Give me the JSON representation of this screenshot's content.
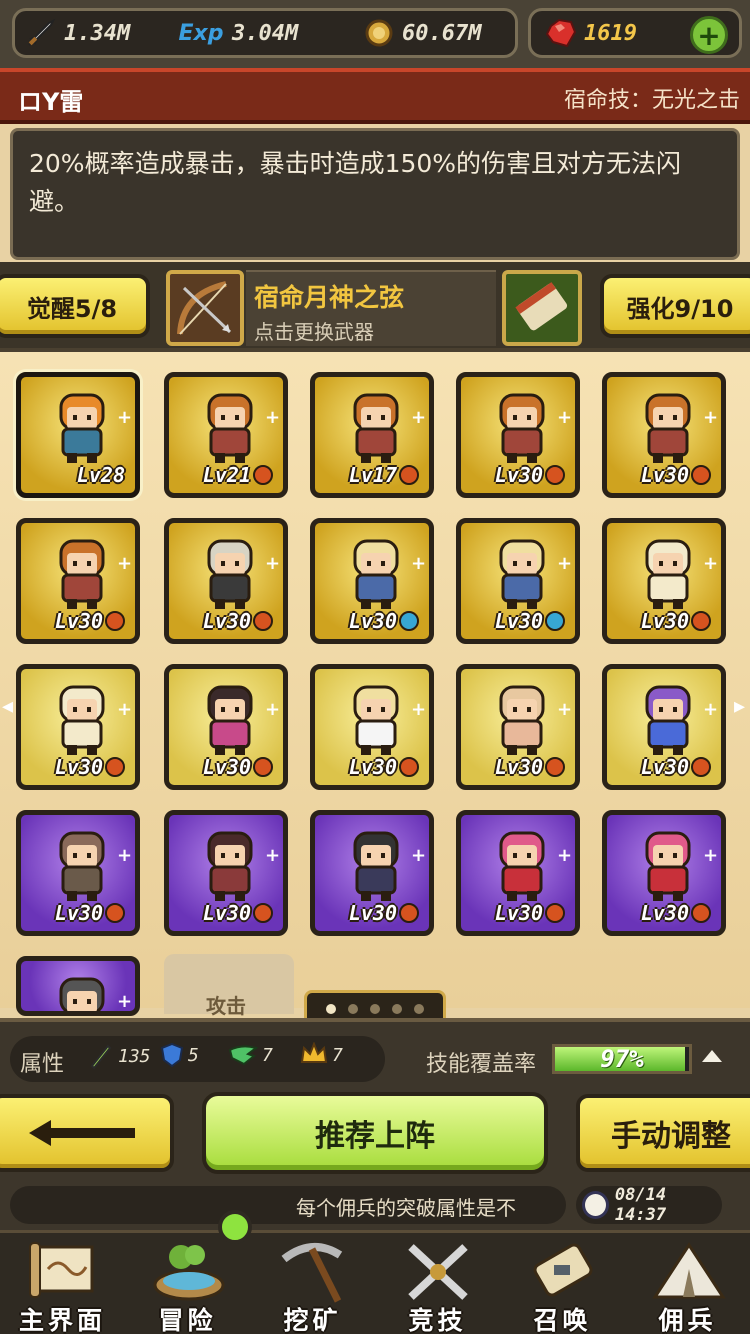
{
  "resources": {
    "attack": "1.34M",
    "exp_icon_text": "Exp",
    "exp": "3.04M",
    "gold": "60.67M",
    "gems": "1619"
  },
  "hero": {
    "name": "ロY雷",
    "fate_skill": "宿命技：无光之击",
    "skill_description": "20%概率造成暴击，暴击时造成150%的伤害且对方无法闪避。"
  },
  "weapon": {
    "awaken_label": "觉醒5/8",
    "name": "宿命月神之弦",
    "hint": "点击更换武器",
    "enhance_label": "强化9/10"
  },
  "heroes": [
    {
      "level": "Lv28",
      "frame": "gold",
      "badge": "none",
      "selected": true
    },
    {
      "level": "Lv21",
      "frame": "gold",
      "badge": "orange"
    },
    {
      "level": "Lv17",
      "frame": "gold",
      "badge": "orange"
    },
    {
      "level": "Lv30",
      "frame": "gold",
      "badge": "orange"
    },
    {
      "level": "Lv30",
      "frame": "gold",
      "badge": "orange"
    },
    {
      "level": "Lv30",
      "frame": "gold",
      "badge": "orange"
    },
    {
      "level": "Lv30",
      "frame": "gold",
      "badge": "orange"
    },
    {
      "level": "Lv30",
      "frame": "gold",
      "badge": "blue"
    },
    {
      "level": "Lv30",
      "frame": "gold",
      "badge": "blue"
    },
    {
      "level": "Lv30",
      "frame": "gold",
      "badge": "orange"
    },
    {
      "level": "Lv30",
      "frame": "goldlight",
      "badge": "orange"
    },
    {
      "level": "Lv30",
      "frame": "goldlight",
      "badge": "orange"
    },
    {
      "level": "Lv30",
      "frame": "goldlight",
      "badge": "orange"
    },
    {
      "level": "Lv30",
      "frame": "goldlight",
      "badge": "orange"
    },
    {
      "level": "Lv30",
      "frame": "goldlight",
      "badge": "orange"
    },
    {
      "level": "Lv30",
      "frame": "purple",
      "badge": "orange"
    },
    {
      "level": "Lv30",
      "frame": "purple",
      "badge": "orange"
    },
    {
      "level": "Lv30",
      "frame": "purple",
      "badge": "orange"
    },
    {
      "level": "Lv30",
      "frame": "purple",
      "badge": "orange"
    },
    {
      "level": "Lv30",
      "frame": "purple",
      "badge": "orange"
    },
    {
      "level": "",
      "frame": "purple",
      "badge": "none"
    }
  ],
  "strategy_label": "攻击",
  "stats": {
    "label": "属性",
    "sword": "135",
    "shield": "5",
    "wing": "7",
    "crown": "7",
    "coverage_label": "技能覆盖率",
    "coverage_percent": 97,
    "coverage_text": "97%"
  },
  "actions": {
    "recommend": "推荐上阵",
    "manual": "手动调整"
  },
  "ticker": {
    "text": "每个佣兵的突破属性是不",
    "time": "08/14 14:37"
  },
  "nav": [
    {
      "label": "主界面",
      "icon": "map-scroll-icon"
    },
    {
      "label": "冒险",
      "icon": "island-icon"
    },
    {
      "label": "挖矿",
      "icon": "pickaxe-icon"
    },
    {
      "label": "竞技",
      "icon": "crossed-swords-icon"
    },
    {
      "label": "召唤",
      "icon": "summon-scroll-icon"
    },
    {
      "label": "佣兵",
      "icon": "tent-icon"
    }
  ],
  "colors": {
    "gold_button": "#f2d845",
    "green_button": "#b9e556",
    "title_bar": "#7a2a18",
    "gem": "#f3c64a"
  }
}
